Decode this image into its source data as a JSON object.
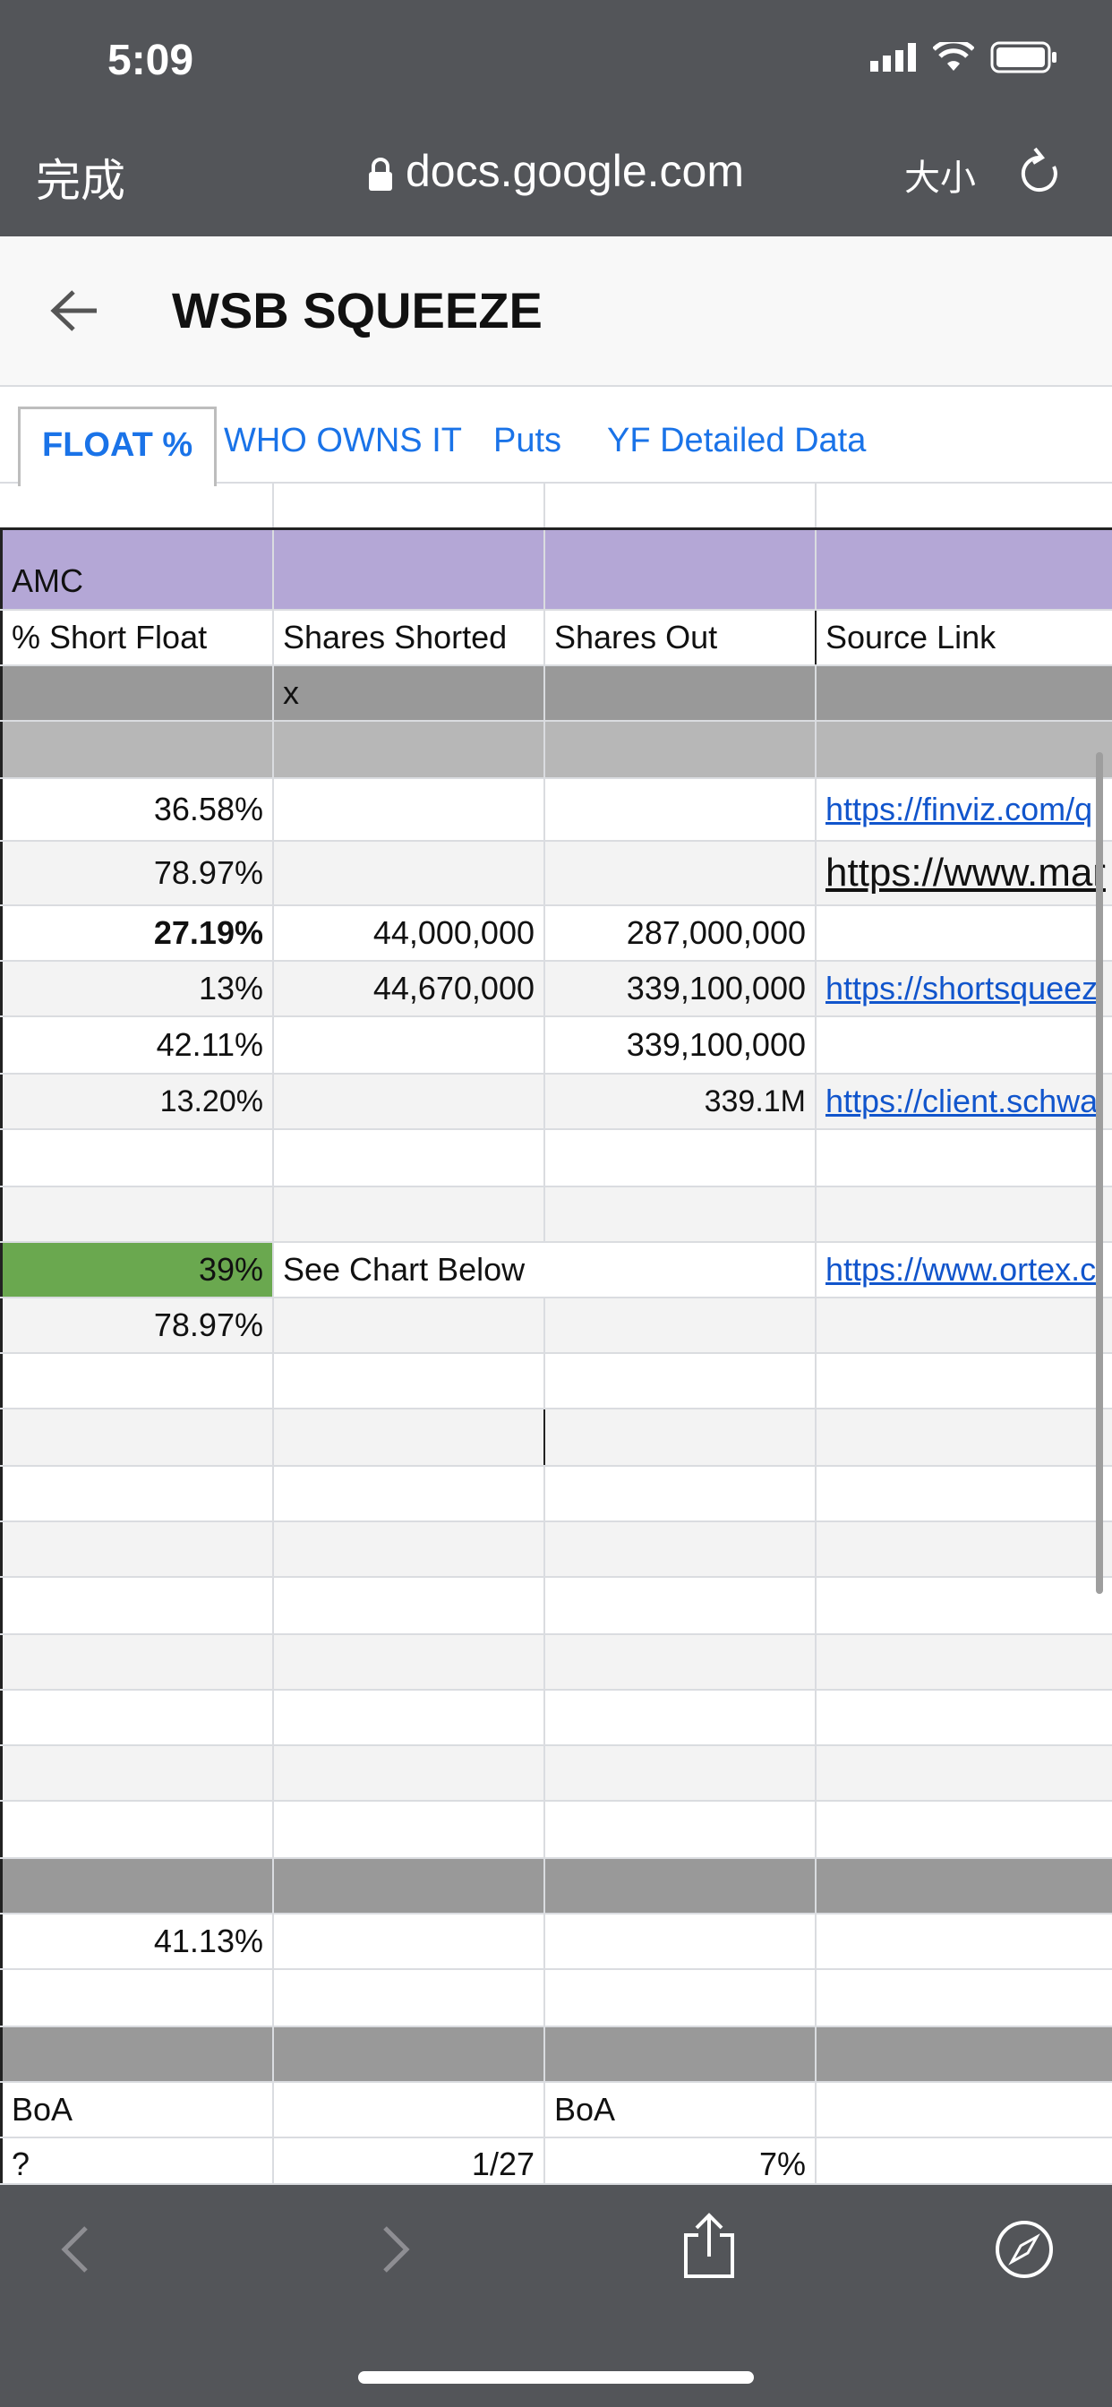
{
  "status": {
    "time": "5:09"
  },
  "browser": {
    "done_label": "完成",
    "url": "docs.google.com",
    "text_size_label": "大小"
  },
  "sheet": {
    "title": "WSB SQUEEZE"
  },
  "tabs": [
    {
      "label": "FLOAT %",
      "active": true
    },
    {
      "label": "WHO OWNS IT",
      "active": false
    },
    {
      "label": "Puts",
      "active": false
    },
    {
      "label": "YF Detailed Data",
      "active": false
    }
  ],
  "table": {
    "ticker": "AMC",
    "headers": [
      "% Short Float",
      "Shares Shorted",
      "Shares Out",
      "Source Link"
    ],
    "marker": "x",
    "rows": [
      [
        "36.58%",
        "",
        "",
        "https://finviz.com/q"
      ],
      [
        "78.97%",
        "",
        "",
        "https://www.mar"
      ],
      [
        "27.19%",
        "44,000,000",
        "287,000,000",
        ""
      ],
      [
        "13%",
        "44,670,000",
        "339,100,000",
        "https://shortsqueez"
      ],
      [
        "42.11%",
        "",
        "339,100,000",
        ""
      ],
      [
        "13.20%",
        "",
        "339.1M",
        "https://client.schwa"
      ],
      [
        "39%",
        "See Chart Below",
        "",
        "https://www.ortex.c"
      ],
      [
        "78.97%",
        "",
        "",
        ""
      ],
      [
        "41.13%",
        "",
        "",
        ""
      ],
      [
        "BoA",
        "",
        "BoA",
        ""
      ],
      [
        "?",
        "1/27",
        "7%",
        ""
      ]
    ]
  },
  "colors": {
    "header_purple": "#b4a7d6",
    "highlight_green": "#6aa84f",
    "link_blue": "#1155cc",
    "tab_blue": "#1a73e8",
    "chrome_gray": "#535559"
  }
}
